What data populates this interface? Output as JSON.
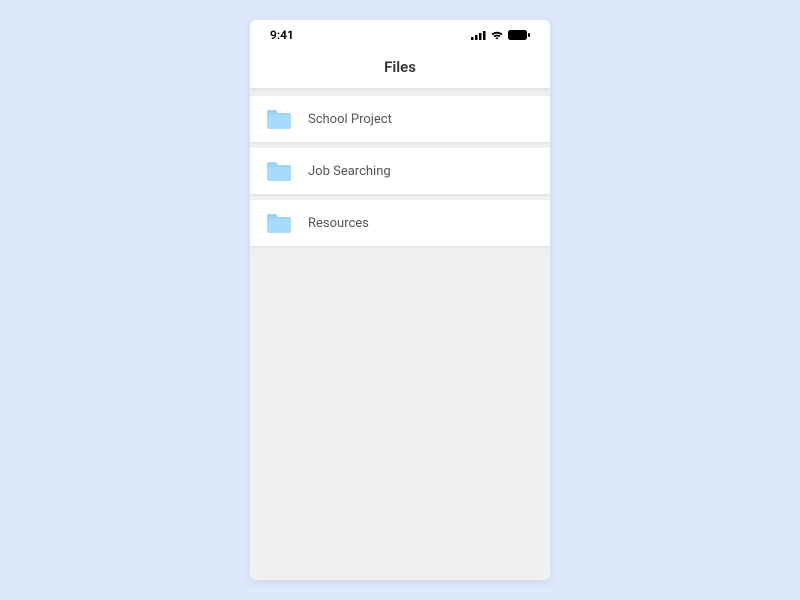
{
  "status": {
    "time": "9:41"
  },
  "nav": {
    "title": "Files"
  },
  "folders": [
    {
      "label": "School Project"
    },
    {
      "label": "Job Searching"
    },
    {
      "label": "Resources"
    }
  ]
}
